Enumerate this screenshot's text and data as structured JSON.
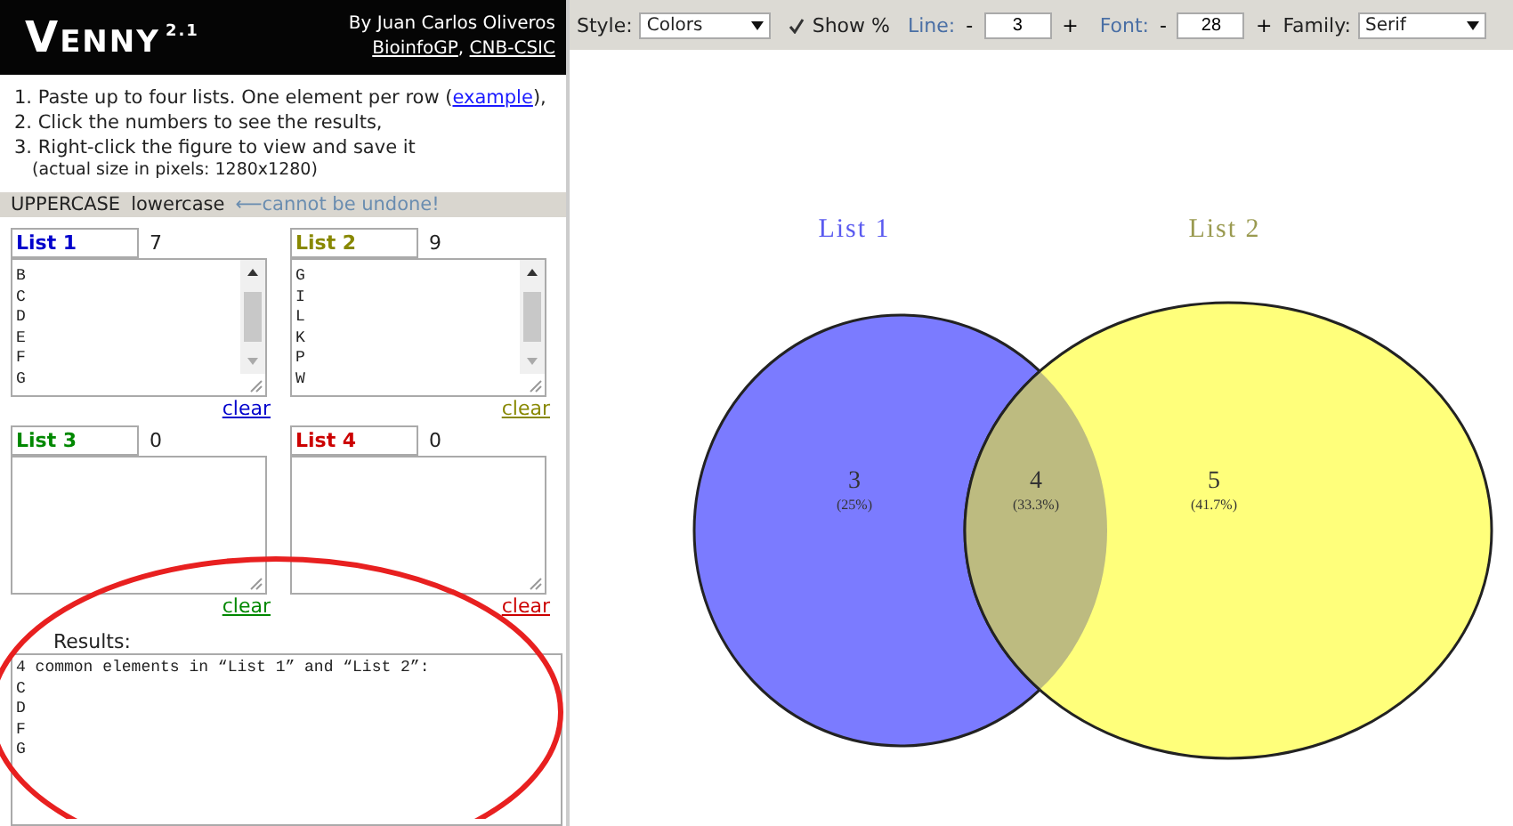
{
  "header": {
    "title": "Venny",
    "version": "2.1",
    "author": "By Juan Carlos Oliveros",
    "links": [
      {
        "text": "BioinfoGP"
      },
      {
        "text": "CNB-CSIC"
      }
    ],
    "separator": ","
  },
  "instructions": [
    {
      "text": "1. Paste up to four lists. One element per row (",
      "link": "example",
      "tail": "),"
    },
    {
      "text": "2. Click the numbers to see the results,"
    },
    {
      "text": "3. Right-click the figure to view and save it"
    },
    {
      "text": "(actual size in pixels: 1280x1280)",
      "kind": "note"
    }
  ],
  "case_bar": {
    "upper": "UPPERCASE",
    "lower": "lowercase",
    "warning": "⟵cannot be undone!"
  },
  "lists": [
    {
      "name": "List 1",
      "count": "7",
      "color": "#0000cc",
      "items": [
        "B",
        "C",
        "D",
        "E",
        "F",
        "G"
      ],
      "scrollbar": true,
      "clear": "clear"
    },
    {
      "name": "List 2",
      "count": "9",
      "color": "#888800",
      "items": [
        "G",
        "I",
        "L",
        "K",
        "P",
        "W"
      ],
      "scrollbar": true,
      "clear": "clear"
    },
    {
      "name": "List 3",
      "count": "0",
      "color": "#008800",
      "scrollbar": false,
      "clear": "clear"
    },
    {
      "name": "List 4",
      "count": "0",
      "color": "#cc0000",
      "scrollbar": false,
      "clear": "clear"
    }
  ],
  "results": {
    "label": "Results:",
    "lines": [
      "4 common elements in “List 1” and “List 2”:",
      "C",
      "D",
      "F",
      "G"
    ]
  },
  "toolbar": {
    "style_label": "Style:",
    "style_value": "Colors",
    "show_percent": {
      "label": "Show %",
      "checked": true
    },
    "line_label": "Line:",
    "line_value": "3",
    "font_label": "Font:",
    "font_value": "28",
    "family_label": "Family:",
    "family_value": "Serif",
    "minus": "-",
    "plus": "+"
  },
  "venn": {
    "sets": [
      {
        "label": "List 1",
        "color": "#7b7bff"
      },
      {
        "label": "List 2",
        "color": "#ffff7b"
      }
    ],
    "regions": [
      {
        "count": "3",
        "percent": "(25%)"
      },
      {
        "count": "4",
        "percent": "(33.3%)"
      },
      {
        "count": "5",
        "percent": "(41.7%)"
      }
    ]
  }
}
